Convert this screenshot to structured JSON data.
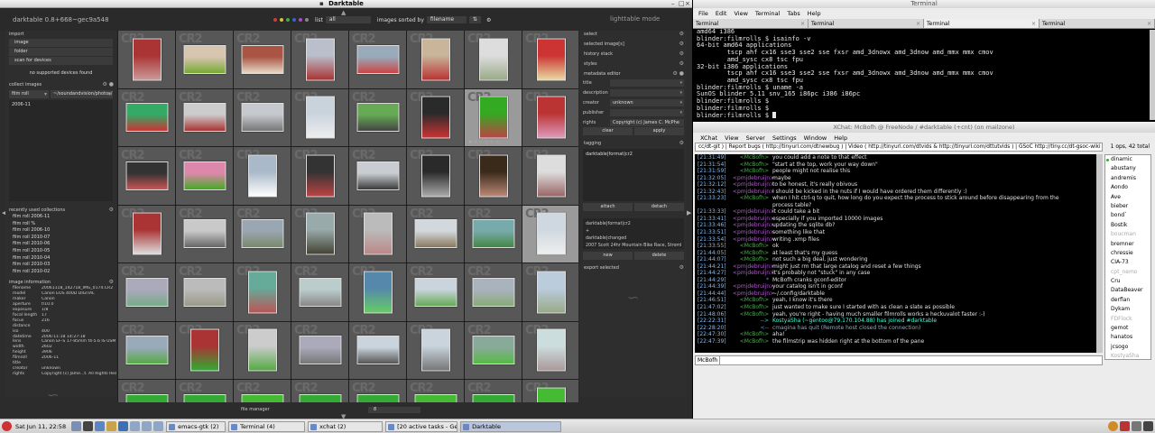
{
  "darktable": {
    "window_title": "Darktable",
    "version": "darktable 0.8+668~gec9a548",
    "filter": {
      "list_label": "list",
      "list_value": "all",
      "sort_label": "images sorted by",
      "sort_value": "filename"
    },
    "mode": "lighttable mode",
    "left": {
      "import": {
        "title": "import",
        "buttons": [
          "image",
          "folder",
          "scan for devices"
        ],
        "no_devices": "no supported devices found"
      },
      "collect": {
        "title": "collect images",
        "criterion": "film roll",
        "path": "~/soundandvision/photos/",
        "items": [
          "2006-11"
        ]
      },
      "recent": {
        "title": "recently used collections",
        "items": [
          "film roll 2006-11",
          "film roll %",
          "film roll 2006-10",
          "film roll 2010-07",
          "film roll 2010-06",
          "film roll 2010-05",
          "film roll 2010-04",
          "film roll 2010-03",
          "film roll 2010-02"
        ]
      },
      "info": {
        "title": "image information",
        "rows": [
          [
            "filename",
            "20061118_142718_IMG_0174.CR2"
          ],
          [
            "model",
            "Canon EOS 400D DIGITAL"
          ],
          [
            "maker",
            "Canon"
          ],
          [
            "aperture",
            "f/10.0"
          ],
          [
            "exposure",
            "1/8"
          ],
          [
            "focal length",
            "17"
          ],
          [
            "focus distance",
            "216"
          ],
          [
            "iso",
            "400"
          ],
          [
            "datetime",
            "2006:11:18 14:27:18"
          ],
          [
            "lens",
            "Canon EF-S 17-85mm f4-5.6 IS USM"
          ],
          [
            "width",
            "2602"
          ],
          [
            "height",
            "3906"
          ],
          [
            "filmroll",
            "2006-11"
          ],
          [
            "title",
            ""
          ],
          [
            "creator",
            "unknown"
          ],
          [
            "rights",
            "Copyright (c) Jame...t. All Rights Reserved"
          ]
        ]
      }
    },
    "right": {
      "sections": [
        "select",
        "selected image[s]",
        "history stack",
        "styles",
        "metadata editor"
      ],
      "metadata": [
        {
          "label": "title",
          "value": ""
        },
        {
          "label": "description",
          "value": ""
        },
        {
          "label": "creator",
          "value": "unknown"
        },
        {
          "label": "publisher",
          "value": ""
        },
        {
          "label": "rights",
          "value": "Copyright (c) James C. McPhe"
        }
      ],
      "meta_buttons": [
        "clear",
        "apply"
      ],
      "tagging_title": "tagging",
      "tag_top": [
        "darktable|format|cr2"
      ],
      "tag_buttons": [
        "attach",
        "detach"
      ],
      "tag_bottom": [
        "darktable|format|cr2",
        "+",
        "darktable|changed",
        "2007 Scott 24hr Mountain Bike Race, Stromlo F"
      ],
      "tag_buttons2": [
        "new",
        "delete"
      ],
      "export_title": "export selected"
    },
    "cr2_badge": "CR2",
    "thumb_selected_index": 31,
    "thumb_hover_index": 14,
    "thumbs": [
      {
        "c1": "#a33",
        "c2": "#c99",
        "p": 1
      },
      {
        "c1": "#d8c5b0",
        "c2": "#7a3",
        "p": 0
      },
      {
        "c1": "#a54",
        "c2": "#e7d9c6",
        "p": 0
      },
      {
        "c1": "#b9c0cc",
        "c2": "#a33",
        "p": 1
      },
      {
        "c1": "#9ab",
        "c2": "#c44",
        "p": 0
      },
      {
        "c1": "#c8b59a",
        "c2": "#b33",
        "p": 1
      },
      {
        "c1": "#ddd",
        "c2": "#9a8",
        "p": 1
      },
      {
        "c1": "#c33",
        "c2": "#e9d9a0",
        "p": 1
      },
      {
        "c1": "#3a6",
        "c2": "#c33",
        "p": 0
      },
      {
        "c1": "#ccc",
        "c2": "#a33",
        "p": 0
      },
      {
        "c1": "#c5c8cc",
        "c2": "#777",
        "p": 0
      },
      {
        "c1": "#c9d3dc",
        "c2": "#eee",
        "p": 1
      },
      {
        "c1": "#6a5",
        "c2": "#444",
        "p": 0
      },
      {
        "c1": "#2a2a2a",
        "c2": "#c33",
        "p": 1
      },
      {
        "c1": "#3a2",
        "c2": "#b44",
        "p": 1
      },
      {
        "c1": "#b33",
        "c2": "#d9b",
        "p": 1
      },
      {
        "c1": "#333",
        "c2": "#c55",
        "p": 0
      },
      {
        "c1": "#d8a",
        "c2": "#4a2",
        "p": 0
      },
      {
        "c1": "#a9b9c9",
        "c2": "#fff",
        "p": 1
      },
      {
        "c1": "#333",
        "c2": "#b44",
        "p": 1
      },
      {
        "c1": "#c9cdd1",
        "c2": "#3a3a3a",
        "p": 0
      },
      {
        "c1": "#2a2a2a",
        "c2": "#aaa",
        "p": 1
      },
      {
        "c1": "#3a2a1a",
        "c2": "#b87",
        "p": 1
      },
      {
        "c1": "#ddd",
        "c2": "#966",
        "p": 1
      },
      {
        "c1": "#a33",
        "c2": "#ddd",
        "p": 1
      },
      {
        "c1": "#c9c9c9",
        "c2": "#666",
        "p": 0
      },
      {
        "c1": "#9aa6b2",
        "c2": "#7a8a6a",
        "p": 0
      },
      {
        "c1": "#9aa",
        "c2": "#443",
        "p": 1
      },
      {
        "c1": "#bbb",
        "c2": "#b88",
        "p": 1
      },
      {
        "c1": "#d2d8de",
        "c2": "#8a7a5a",
        "p": 0
      },
      {
        "c1": "#7aa",
        "c2": "#484",
        "p": 0
      },
      {
        "c1": "#cfd8e0",
        "c2": "#eee",
        "p": 1
      },
      {
        "c1": "#aab",
        "c2": "#7a8",
        "p": 0
      },
      {
        "c1": "#bbb",
        "c2": "#998",
        "p": 0
      },
      {
        "c1": "#6a9",
        "c2": "#b55",
        "p": 1
      },
      {
        "c1": "#bcc",
        "c2": "#888",
        "p": 0
      },
      {
        "c1": "#58a",
        "c2": "#6c6",
        "p": 1
      },
      {
        "c1": "#c9d4dc",
        "c2": "#6a5",
        "p": 0
      },
      {
        "c1": "#a9b3bd",
        "c2": "#8a7",
        "p": 0
      },
      {
        "c1": "#bcd",
        "c2": "#9a8",
        "p": 1
      },
      {
        "c1": "#9ab",
        "c2": "#5a4",
        "p": 0
      },
      {
        "c1": "#a33",
        "c2": "#3a3",
        "p": 1
      },
      {
        "c1": "#ccc",
        "c2": "#5a4",
        "p": 1
      },
      {
        "c1": "#aab",
        "c2": "#777",
        "p": 0
      },
      {
        "c1": "#c9d4dc",
        "c2": "#555",
        "p": 0
      },
      {
        "c1": "#c9d4dc",
        "c2": "#777",
        "p": 1
      },
      {
        "c1": "#8a9",
        "c2": "#5b4",
        "p": 0
      },
      {
        "c1": "#cdd",
        "c2": "#a99",
        "p": 1
      },
      {
        "c1": "#3a3",
        "c2": "#5c4",
        "p": 0
      },
      {
        "c1": "#3a3",
        "c2": "#6c5",
        "p": 0
      },
      {
        "c1": "#4b3",
        "c2": "#6c5",
        "p": 0
      },
      {
        "c1": "#3a3",
        "c2": "#5b4",
        "p": 0
      },
      {
        "c1": "#3a3",
        "c2": "#6c5",
        "p": 0
      },
      {
        "c1": "#4b3",
        "c2": "#5c4",
        "p": 0
      },
      {
        "c1": "#3a3",
        "c2": "#6c5",
        "p": 0
      },
      {
        "c1": "#4b3",
        "c2": "#6c5",
        "p": 1
      }
    ],
    "bottom": {
      "panel": "file manager",
      "zoom": "8"
    }
  },
  "terminal": {
    "window_title": "Terminal",
    "menu": [
      "File",
      "Edit",
      "View",
      "Terminal",
      "Tabs",
      "Help"
    ],
    "tabs": [
      "Terminal",
      "Terminal",
      "Terminal",
      "Terminal"
    ],
    "active_tab": 2,
    "lines": [
      "amd64 i386",
      "blinder:filmrolls $ isainfo -v",
      "64-bit amd64 applications",
      "        tscp ahf cx16 sse3 sse2 sse fxsr amd_3dnowx amd_3dnow amd_mmx mmx cmov",
      "        amd_sysc cx8 tsc fpu",
      "32-bit i386 applications",
      "        tscp ahf cx16 sse3 sse2 sse fxsr amd_3dnowx amd_3dnow amd_mmx mmx cmov",
      "        amd_sysc cx8 tsc fpu",
      "blinder:filmrolls $ uname -a",
      "SunOS blinder 5.11 snv_165 i86pc i386 i86pc",
      "blinder:filmrolls $",
      "blinder:filmrolls $",
      "blinder:filmrolls $ "
    ]
  },
  "xchat": {
    "window_title": "XChat: McBofh @ FreeNode / #darktable (+cnt) (on mailzone)",
    "menu": [
      "XChat",
      "View",
      "Server",
      "Settings",
      "Window",
      "Help"
    ],
    "topic": "cc/dt-git ) | Report bugs ( http://tinyurl.com/dtnewbug ) | Video ( http://tinyurl.com/dtvids & http://tinyurl.com/dttutvids ) | GSoC http://tiny.cc/dt-gsoc-wiki",
    "user_count": "1 ops, 42 total",
    "colors": {
      "mcbofh": "#4ab04a",
      "pmjdebruijn": "#b25bd0",
      "system": "#5c8ee0",
      "joins": "#3cc"
    },
    "messages": [
      {
        "t": "[21:31:49]",
        "n": "<McBofh>",
        "c": "mcbofh",
        "m": "you could add a note to that effect"
      },
      {
        "t": "[21:31:54]",
        "n": "<McBofh>",
        "c": "mcbofh",
        "m": "\"start at the top, work your way down\""
      },
      {
        "t": "[21:31:59]",
        "n": "<McBofh>",
        "c": "mcbofh",
        "m": "people might not realise this"
      },
      {
        "t": "[21:32:05]",
        "n": "<pmjdebruijn>",
        "c": "pmjdebruijn",
        "m": "maybe"
      },
      {
        "t": "[21:32:12]",
        "n": "<pmjdebruijn>",
        "c": "pmjdebruijn",
        "m": "to be honest, it's really obivous"
      },
      {
        "t": "[21:32:43]",
        "n": "<pmjdebruijn>",
        "c": "pmjdebruijn",
        "m": "I should be kicked in the nuts if I would have ordered them differently :)"
      },
      {
        "t": "[21:33:23]",
        "n": "<McBofh>",
        "c": "mcbofh",
        "m": "when I hit ctrl-q to quit, how long do you expect the process to stick around before disappearing from the"
      },
      {
        "t": "",
        "n": "",
        "c": "mcbofh",
        "m": "process table?"
      },
      {
        "t": "[21:33:33]",
        "n": "<pmjdebruijn>",
        "c": "pmjdebruijn",
        "m": "it could take a bit"
      },
      {
        "t": "[21:33:41]",
        "n": "<pmjdebruijn>",
        "c": "pmjdebruijn",
        "m": "especially if you imported 10000 images"
      },
      {
        "t": "[21:33:46]",
        "n": "<pmjdebruijn>",
        "c": "pmjdebruijn",
        "m": "updating the sqlite db?"
      },
      {
        "t": "[21:33:51]",
        "n": "<pmjdebruijn>",
        "c": "pmjdebruijn",
        "m": "something like that"
      },
      {
        "t": "[21:33:54]",
        "n": "<pmjdebruijn>",
        "c": "pmjdebruijn",
        "m": "writing .xmp files"
      },
      {
        "t": "[21:33:55]",
        "n": "<McBofh>",
        "c": "mcbofh",
        "m": "ok"
      },
      {
        "t": "[21:44:05]",
        "n": "<McBofh>",
        "c": "mcbofh",
        "m": "at least that's my guess"
      },
      {
        "t": "[21:44:07]",
        "n": "<McBofh>",
        "c": "mcbofh",
        "m": "not such a big deal, just wondering"
      },
      {
        "t": "[21:44:21]",
        "n": "<pmjdebruijn>",
        "c": "pmjdebruijn",
        "m": "might just rm that large catalog and reset a few things"
      },
      {
        "t": "[21:44:27]",
        "n": "<pmjdebruijn>",
        "c": "pmjdebruijn",
        "m": "it's probably not \"stuck\" in any case"
      },
      {
        "t": "[21:44:29]",
        "n": "*",
        "c": "system",
        "m": "McBofh cranks gconf-editor"
      },
      {
        "t": "[21:44:39]",
        "n": "<pmjdebruijn>",
        "c": "pmjdebruijn",
        "m": "your catalog isn't in gconf"
      },
      {
        "t": "[21:44:44]",
        "n": "<pmjdebruijn>",
        "c": "pmjdebruijn",
        "m": "~/.config/darktable"
      },
      {
        "t": "[21:46:51]",
        "n": "<McBofh>",
        "c": "mcbofh",
        "m": "yeah, I know it's there"
      },
      {
        "t": "[21:47:02]",
        "n": "<McBofh>",
        "c": "mcbofh",
        "m": "just wanted to make sure I started with as clean a slate as possible"
      },
      {
        "t": "[21:48:06]",
        "n": "<McBofh>",
        "c": "mcbofh",
        "m": "yeah, you're right - having much smaller filmrolls works a heckuvalot faster :-)"
      },
      {
        "t": "[22:22:31]",
        "n": "-->",
        "c": "joins",
        "m": "KostyaSha (~gentoo@79.170.104.88) has joined #darktable"
      },
      {
        "t": "[22:28:20]",
        "n": "<--",
        "c": "system",
        "m": "cmagina has quit (Remote host closed the connection)"
      },
      {
        "t": "[22:47:30]",
        "n": "<McBofh>",
        "c": "mcbofh",
        "m": "aha!"
      },
      {
        "t": "[22:47:39]",
        "n": "<McBofh>",
        "c": "mcbofh",
        "m": "the filmstrip was hidden right at the bottom of the pane"
      }
    ],
    "users": [
      {
        "n": "dinamic",
        "op": true,
        "gone": false
      },
      {
        "n": "abustany",
        "op": false,
        "gone": false
      },
      {
        "n": "andremis",
        "op": false,
        "gone": false
      },
      {
        "n": "Aondo",
        "op": false,
        "gone": false
      },
      {
        "n": "Ave",
        "op": false,
        "gone": false
      },
      {
        "n": "bieber",
        "op": false,
        "gone": false
      },
      {
        "n": "bond`",
        "op": false,
        "gone": false
      },
      {
        "n": "Bostik",
        "op": false,
        "gone": false
      },
      {
        "n": "boucman",
        "op": false,
        "gone": true
      },
      {
        "n": "bremner",
        "op": false,
        "gone": false
      },
      {
        "n": "chressie",
        "op": false,
        "gone": false
      },
      {
        "n": "CIA-73",
        "op": false,
        "gone": false
      },
      {
        "n": "cpt_nemo",
        "op": false,
        "gone": true
      },
      {
        "n": "Cru",
        "op": false,
        "gone": false
      },
      {
        "n": "DataBeaver",
        "op": false,
        "gone": false
      },
      {
        "n": "derflan",
        "op": false,
        "gone": false
      },
      {
        "n": "Dykam",
        "op": false,
        "gone": false
      },
      {
        "n": "FDFlock",
        "op": false,
        "gone": true
      },
      {
        "n": "gemot",
        "op": false,
        "gone": false
      },
      {
        "n": "hanatos",
        "op": false,
        "gone": false
      },
      {
        "n": "jcsogo",
        "op": false,
        "gone": false
      },
      {
        "n": "KostyaSha",
        "op": false,
        "gone": true
      }
    ],
    "nick": "McBofh"
  },
  "taskbar": {
    "clock": "Sat Jun 11, 22:58",
    "tasks": [
      {
        "label": "emacs-gtk (2)",
        "w": 66,
        "act": false
      },
      {
        "label": "Terminal (4)",
        "w": 85,
        "act": false
      },
      {
        "label": "xchat (2)",
        "w": 83,
        "act": false
      },
      {
        "label": "[20 active tasks - Getti...",
        "w": 80,
        "act": false
      },
      {
        "label": "Darktable",
        "w": 112,
        "act": true
      }
    ]
  }
}
